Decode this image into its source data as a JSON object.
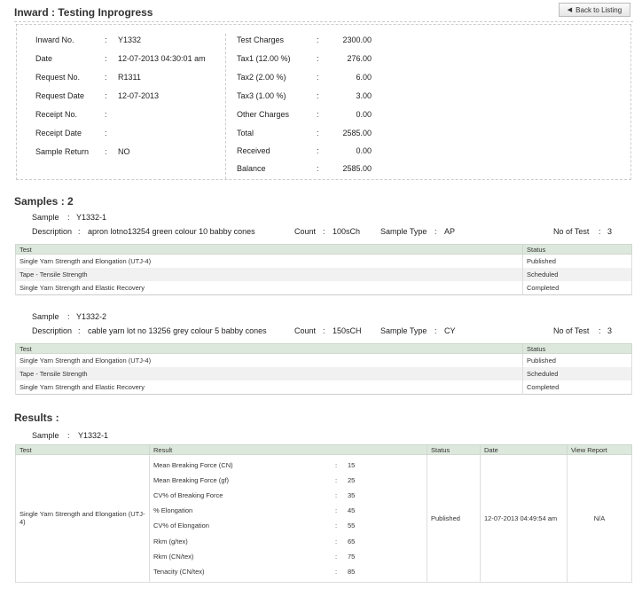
{
  "header": {
    "title": "Inward : Testing Inprogress",
    "back_label": "Back to Listing"
  },
  "inward_left": [
    {
      "label": "Inward No.",
      "value": "Y1332"
    },
    {
      "label": "Date",
      "value": "12-07-2013 04:30:01 am"
    },
    {
      "label": "Request No.",
      "value": "R1311"
    },
    {
      "label": "Request Date",
      "value": "12-07-2013"
    },
    {
      "label": "Receipt No.",
      "value": ""
    },
    {
      "label": "Receipt Date",
      "value": ""
    },
    {
      "label": "Sample Return",
      "value": "NO"
    }
  ],
  "inward_right": [
    {
      "label": "Test Charges",
      "value": "2300.00"
    },
    {
      "label": "Tax1 (12.00 %)",
      "value": "276.00"
    },
    {
      "label": "Tax2 (2.00 %)",
      "value": "6.00"
    },
    {
      "label": "Tax3 (1.00 %)",
      "value": "3.00"
    },
    {
      "label": "Other Charges",
      "value": "0.00"
    },
    {
      "label": "Total",
      "value": "2585.00"
    },
    {
      "label": "Received",
      "value": "0.00"
    },
    {
      "label": "Balance",
      "value": "2585.00"
    }
  ],
  "colon": ":",
  "samples": {
    "title": "Samples : 2",
    "labels": {
      "sample": "Sample",
      "description": "Description",
      "count": "Count",
      "sample_type": "Sample Type",
      "no_of_test": "No of Test"
    },
    "columns": {
      "test": "Test",
      "status": "Status"
    },
    "items": [
      {
        "sample": "Y1332-1",
        "description": "apron lotno13254 green colour 10 babby cones",
        "count": "100sCh",
        "sample_type": "AP",
        "no_of_test": "3",
        "rows": [
          {
            "test": "Single Yarn Strength and Elongation (UTJ-4)",
            "status": "Published"
          },
          {
            "test": "Tape - Tensile Strength",
            "status": "Scheduled"
          },
          {
            "test": "Single Yarn Strength and Elastic Recovery",
            "status": "Completed"
          }
        ]
      },
      {
        "sample": "Y1332-2",
        "description": "cable yarn lot no 13256 grey colour 5 babby cones",
        "count": "150sCH",
        "sample_type": "CY",
        "no_of_test": "3",
        "rows": [
          {
            "test": "Single Yarn Strength and Elongation (UTJ-4)",
            "status": "Published"
          },
          {
            "test": "Tape - Tensile Strength",
            "status": "Scheduled"
          },
          {
            "test": "Single Yarn Strength and Elastic Recovery",
            "status": "Completed"
          }
        ]
      }
    ]
  },
  "results": {
    "title": "Results :",
    "sample_label": "Sample",
    "sample": "Y1332-1",
    "columns": {
      "test": "Test",
      "result": "Result",
      "status": "Status",
      "date": "Date",
      "view_report": "View Report"
    },
    "row": {
      "test": "Single Yarn Strength and Elongation (UTJ-4)",
      "status": "Published",
      "date": "12-07-2013 04:49:54 am",
      "view_report": "N/A",
      "measures": [
        {
          "label": "Mean Breaking Force (CN)",
          "value": "15"
        },
        {
          "label": "Mean Breaking Force (gf)",
          "value": "25"
        },
        {
          "label": "CV% of Breaking Force",
          "value": "35"
        },
        {
          "label": "% Elongation",
          "value": "45"
        },
        {
          "label": "CV% of Elongation",
          "value": "55"
        },
        {
          "label": "Rkm (g/tex)",
          "value": "65"
        },
        {
          "label": "Rkm (CN/tex)",
          "value": "75"
        },
        {
          "label": "Tenacity (CN/tex)",
          "value": "85"
        }
      ]
    }
  }
}
